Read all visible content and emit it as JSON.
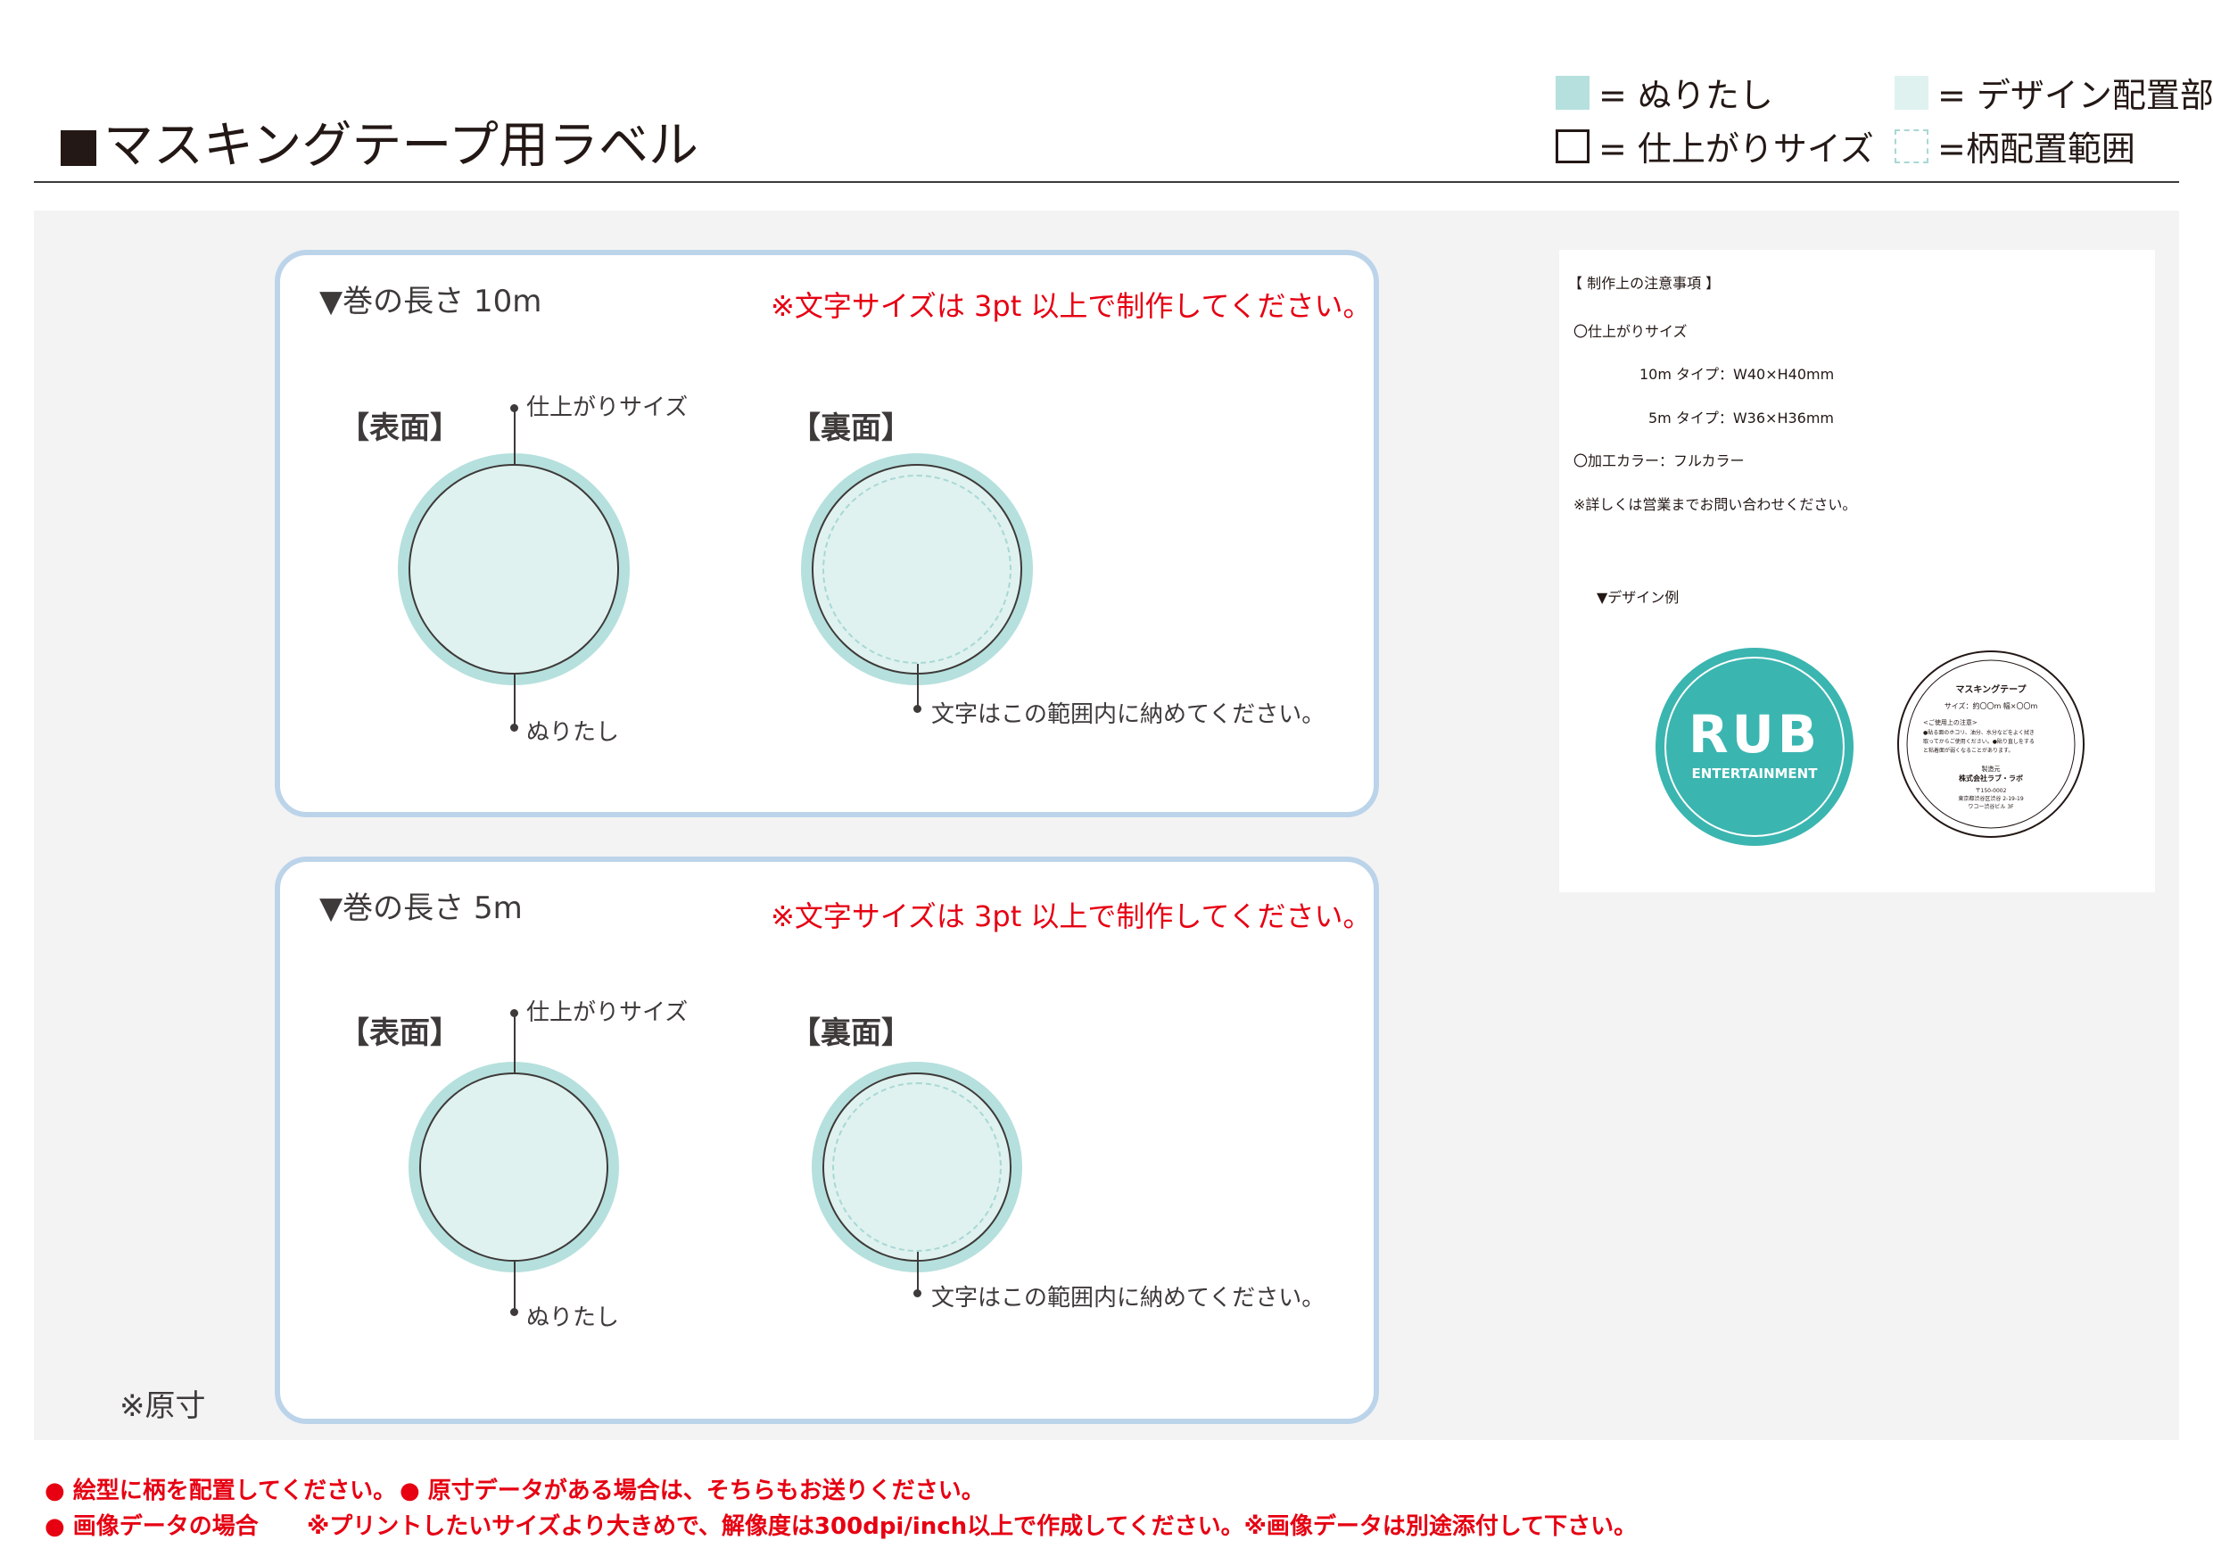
{
  "header": {
    "title": "マスキングテープ用ラベル",
    "legend": {
      "bleed": "= ぬりたし",
      "trim": "= 仕上がりサイズ",
      "design": "= デザイン配置部",
      "area": "=柄配置範囲"
    }
  },
  "panels": [
    {
      "length": "▼巻の長さ 10m",
      "warning": "※文字サイズは 3pt 以上で制作してください。",
      "front_label": "【表面】",
      "back_label": "【裏面】",
      "trim_label": "仕上がりサイズ",
      "bleed_label": "ぬりたし",
      "area_label": "文字はこの範囲内に納めてください。"
    },
    {
      "length": "▼巻の長さ 5m",
      "warning": "※文字サイズは 3pt 以上で制作してください。",
      "front_label": "【表面】",
      "back_label": "【裏面】",
      "trim_label": "仕上がりサイズ",
      "bleed_label": "ぬりたし",
      "area_label": "文字はこの範囲内に納めてください。"
    }
  ],
  "original_size_note": "※原寸",
  "notes": {
    "heading": "【 制作上の注意事項 】",
    "finish_size_title": "〇仕上がりサイズ",
    "size_10m": "10m タイプ：W40×H40mm",
    "size_5m": "5m タイプ：W36×H36mm",
    "color": "〇加工カラー：フルカラー",
    "contact": "※詳しくは営業までお問い合わせください。",
    "example_heading": "▼デザイン例",
    "example_front": {
      "logo": "RUB",
      "sub": "ENTERTAINMENT",
      "color": "#3bb5b0"
    },
    "example_back": {
      "title": "マスキングテープ",
      "size": "サイズ：約〇〇m 幅×〇〇m",
      "caution_title": "<ご使用上の注意>",
      "caution_1": "●貼る面のホコリ、油分、水分などをよく拭き",
      "caution_2": "取ってからご使用ください。●貼り直しをする",
      "caution_3": "と粘着面が弱くなることがあります。",
      "maker_label": "製造元",
      "maker": "株式会社ラブ・ラボ",
      "zip": "〒150-0002",
      "addr_1": "東京都渋谷区渋谷 2-19-19",
      "addr_2": "ワコー渋谷ビル 3F"
    }
  },
  "footer": {
    "line1a": "● 絵型に柄を配置してください。",
    "line1b": "● 原寸データがある場合は、そちらもお送りください。",
    "line2a": "● 画像データの場合",
    "line2b": "※プリントしたいサイズより大きめで、解像度は300dpi/inch以上で作成してください。※画像データは別途添付して下さい。"
  },
  "colors": {
    "bleed": "#b5e0dd",
    "design": "#dff2f0",
    "panel_border": "#bcd4ea",
    "warning": "#e60012"
  }
}
